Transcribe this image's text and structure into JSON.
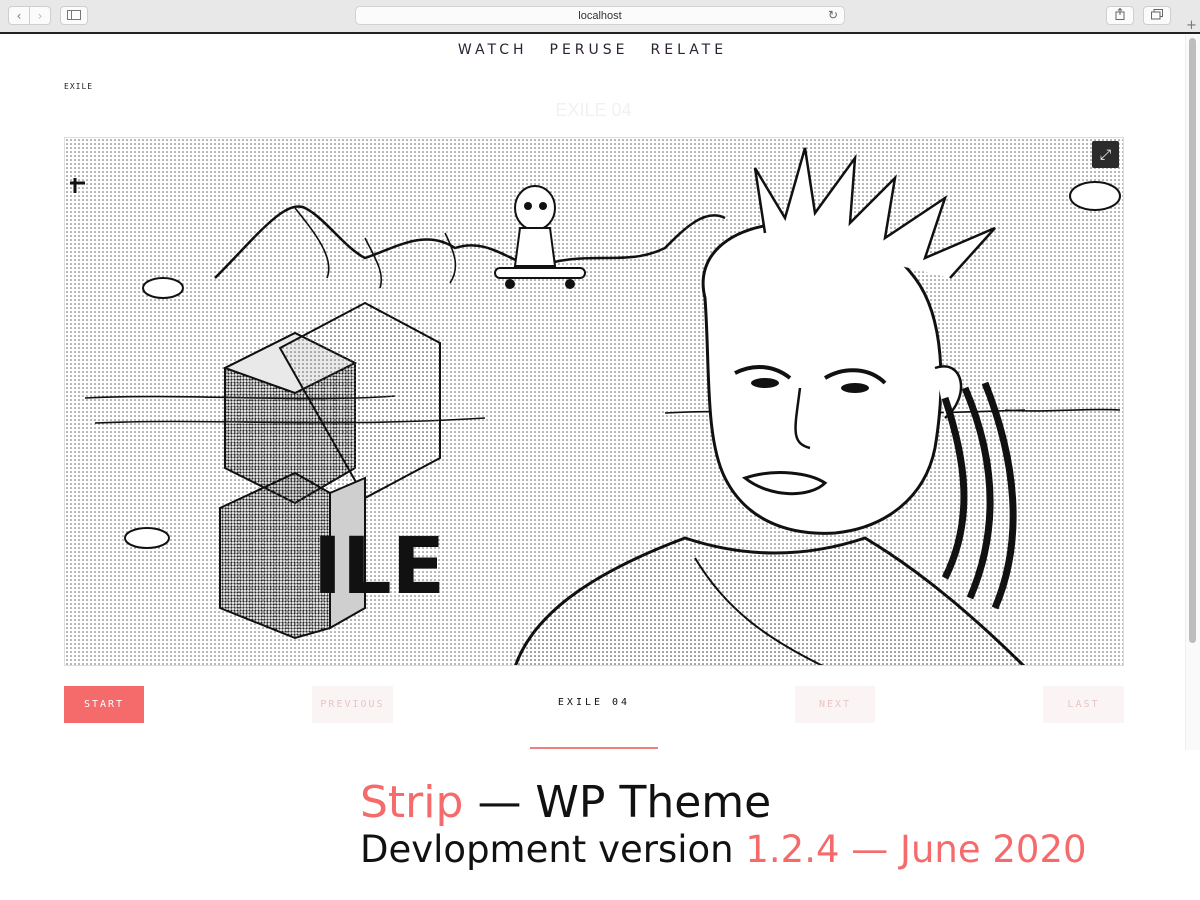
{
  "browser": {
    "address": "localhost"
  },
  "nav": {
    "items": [
      {
        "label": "WATCH"
      },
      {
        "label": "PERUSE"
      },
      {
        "label": "RELATE"
      }
    ]
  },
  "breadcrumb": "EXILE",
  "page_title": "EXILE 04",
  "panel": {
    "logo_text": "ILE"
  },
  "pagination": {
    "start": "START",
    "previous": "PREVIOUS",
    "current": "EXILE 04",
    "next": "NEXT",
    "last": "LAST"
  },
  "promo": {
    "brand": "Strip",
    "title_rest": "— WP Theme",
    "dev_label": "Devlopment version",
    "version": "1.2.4 — June 2020"
  },
  "colors": {
    "accent": "#f56b6b",
    "nav_text": "#2c2233",
    "disabled_bg": "#fbf4f4"
  },
  "icons": {
    "back": "chevron-left-icon",
    "forward": "chevron-right-icon",
    "sidebar": "sidebar-icon",
    "reload": "reload-icon",
    "share": "share-icon",
    "tabs": "tabs-icon",
    "expand": "expand-icon"
  }
}
